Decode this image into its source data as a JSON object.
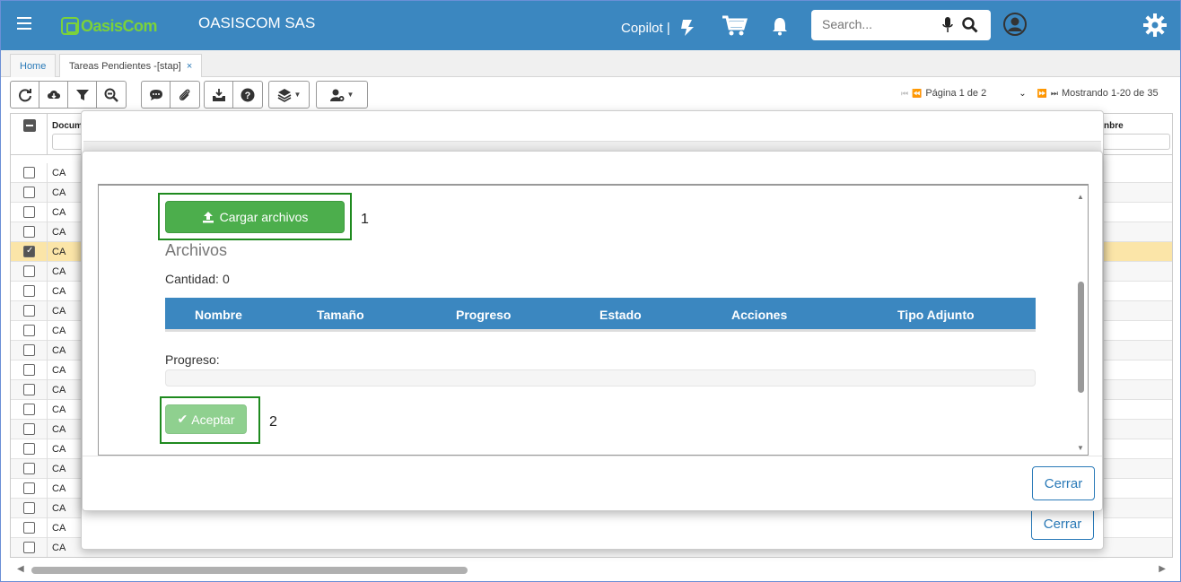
{
  "header": {
    "company": "OASISCOM SAS",
    "logo_text": "OasisCom",
    "copilot_label": "Copilot |",
    "search_placeholder": "Search...",
    "colors": {
      "topbar": "#3b87c0",
      "logo": "#7bd23a"
    }
  },
  "tabs": [
    {
      "label": "Home"
    },
    {
      "label": "Tareas Pendientes -[stap]",
      "close": "×"
    }
  ],
  "toolbar": {
    "buttons": [
      "refresh-icon",
      "cloud-download-icon",
      "filter-icon",
      "zoom-out-icon",
      "comment-icon",
      "paperclip-icon",
      "inbox-icon",
      "help-icon",
      "layers-icon",
      "user-settings-icon"
    ]
  },
  "pager": {
    "page_text": "Página 1 de 2",
    "showing_text": "Mostrando 1-20 de 35"
  },
  "grid": {
    "col_documento": "Docum",
    "col_nombre": "nbre",
    "row_code": "CA",
    "rows": [
      "CA",
      "CA",
      "CA",
      "CA",
      "CA",
      "CA",
      "CA",
      "CA",
      "CA",
      "CA",
      "CA",
      "CA",
      "CA",
      "CA",
      "CA",
      "CA",
      "CA",
      "CA",
      "CA",
      "CA"
    ],
    "selected_row": 4
  },
  "dialog": {
    "upload_button": "Cargar archivos",
    "marker_1": "1",
    "files_title": "Archivos",
    "count_label": "Cantidad:",
    "count_value": "0",
    "columns": [
      "Nombre",
      "Tamaño",
      "Progreso",
      "Estado",
      "Acciones",
      "Tipo Adjunto"
    ],
    "progress_label": "Progreso:",
    "progress_value": 0,
    "accept_button": "Aceptar",
    "marker_2": "2",
    "close_button": "Cerrar"
  },
  "outer_dialog": {
    "close_button": "Cerrar"
  }
}
